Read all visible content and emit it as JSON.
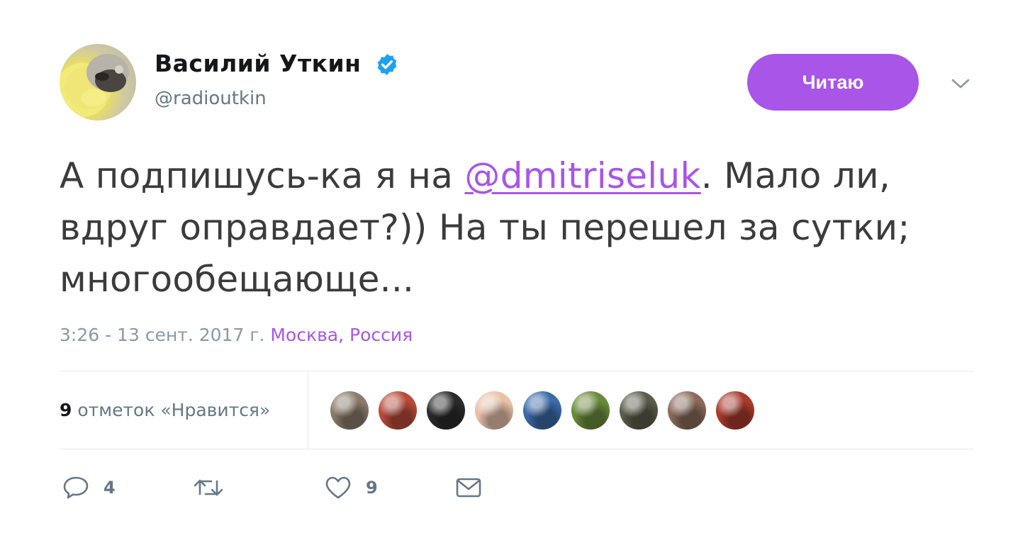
{
  "user": {
    "name": "Василий Уткин",
    "handle": "@radioutkin",
    "verified": true
  },
  "follow_button": {
    "label": "Читаю"
  },
  "tweet": {
    "text_before": "А подпишусь-ка я на ",
    "mention": "@dmitriseluk",
    "text_after": ". Мало ли, вдруг оправдает?)) На ты перешел за сутки; многообещающе..."
  },
  "meta": {
    "timestamp": "3:26 - 13 сент. 2017 г.",
    "location": "Москва, Россия"
  },
  "likes": {
    "count": "9",
    "label": "отметок «Нравится»",
    "avatars": [
      {
        "color": "#8a7a6a"
      },
      {
        "color": "#b84a3a"
      },
      {
        "color": "#2a2a2a"
      },
      {
        "color": "#e8c0a8"
      },
      {
        "color": "#3a6aa8"
      },
      {
        "color": "#6a8a3a"
      },
      {
        "color": "#5a5a4a"
      },
      {
        "color": "#8a6a5a"
      },
      {
        "color": "#a83a2a"
      }
    ]
  },
  "actions": {
    "reply_count": "4",
    "retweet_count": "",
    "like_count": "9"
  },
  "colors": {
    "accent": "#a855e8",
    "verified": "#1da1f2",
    "muted": "#657786"
  }
}
